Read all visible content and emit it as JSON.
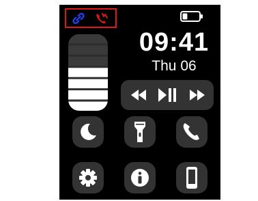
{
  "status_bar": {
    "link_icon": "link-icon",
    "call_icon": "missed-call-icon",
    "battery_icon": "battery-icon",
    "battery_level": 0.3,
    "highlight_color": "#e01818",
    "icon_color": "#1f3fe0"
  },
  "clock": {
    "time": "09:41",
    "date": "Thu  06"
  },
  "brightness": {
    "level": 0.5,
    "levels": 7
  },
  "media": {
    "controls": [
      "previous-icon",
      "play-pause-icon",
      "next-icon"
    ]
  },
  "quick_actions": [
    {
      "name": "do-not-disturb",
      "icon": "moon-icon"
    },
    {
      "name": "flashlight",
      "icon": "flashlight-icon"
    },
    {
      "name": "phone",
      "icon": "phone-icon"
    },
    {
      "name": "settings",
      "icon": "gear-icon"
    },
    {
      "name": "info",
      "icon": "info-icon"
    },
    {
      "name": "find-phone",
      "icon": "smartphone-icon"
    }
  ]
}
